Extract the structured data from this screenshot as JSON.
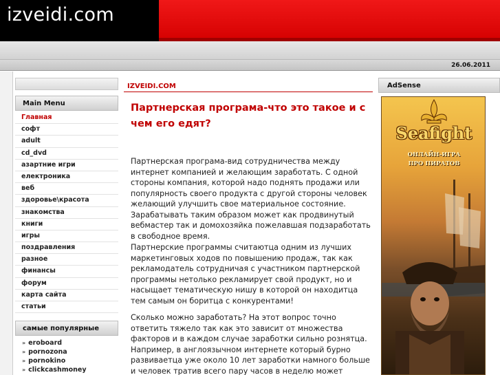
{
  "header": {
    "site_title": "izveidi.com",
    "date": "26.06.2011"
  },
  "sidebar": {
    "main_menu_title": "Main Menu",
    "main_menu": [
      "Главная",
      "софт",
      "adult",
      "cd_dvd",
      "азартние игри",
      "електроника",
      "веб",
      "здоровье\\красота",
      "знакомства",
      "книги",
      "игры",
      "поздравления",
      "разное",
      "финансы",
      "форум",
      "карта сайта",
      "статьи"
    ],
    "popular_title": "самые популярные",
    "popular": [
      "eroboard",
      "pornozona",
      "pornokino",
      "clickcashmoney"
    ]
  },
  "content": {
    "crumb": "IZVEIDI.COM",
    "title": "Партнерская програма-что это такое и с чем его едят?",
    "paragraphs": [
      "Партнерская програма-вид сотрудничества между интернет компанией и желающим заработать. С одной стороны компания, которой надо поднять продажи или популярность своего продукта с другой стороны человек желающий улучшить свое материальное состояние. Зарабатывать таким образом может как продвинутый вебмастер так и домохозяйка пожелавшая подзаработать в свободное время.",
      "Партнерские программы считаютца одним из лучших маркетинговых ходов по повышению продаж, так как рекламодатель сотрудничая с участником партнерской программы нетолько рекламирует свой продукт, но и насыщает тематическую нишу в которой он находитца тем самым он боритца с конкурентами!",
      "Сколько можно заработать? На этот вопрос точно ответить тяжело так как это зависит от множества факторов и в каждом случае заработки сильно рознятца. Например, в англоязычном интернете который бурно развиваетца уже около 10 лет заработки намного больше и человек тратив всего пару часов в неделю может получать"
    ]
  },
  "adsense": {
    "title": "AdSense",
    "banner_logo": "Seafight",
    "banner_line1": "ОНЛАЙН-ИГРА",
    "banner_line2": "ПРО ПИРАТОВ"
  },
  "colors": {
    "accent": "#c00000",
    "header_bg": "#000000",
    "header_red": "#e00000"
  }
}
